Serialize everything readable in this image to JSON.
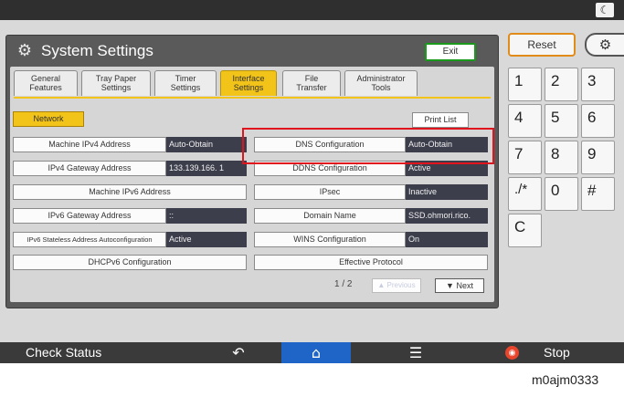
{
  "title": "System Settings",
  "exit_label": "Exit",
  "tabs": [
    {
      "line1": "General",
      "line2": "Features"
    },
    {
      "line1": "Tray Paper",
      "line2": "Settings"
    },
    {
      "line1": "Timer",
      "line2": "Settings"
    },
    {
      "line1": "Interface",
      "line2": "Settings"
    },
    {
      "line1": "File",
      "line2": "Transfer"
    },
    {
      "line1": "Administrator",
      "line2": "Tools"
    }
  ],
  "active_tab_index": 3,
  "network_label": "Network",
  "print_list_label": "Print List",
  "left_items": [
    {
      "label": "Machine IPv4 Address",
      "value": "Auto-Obtain"
    },
    {
      "label": "IPv4 Gateway Address",
      "value": "133.139.166.  1"
    },
    {
      "label": "Machine IPv6 Address",
      "value": ""
    },
    {
      "label": "IPv6 Gateway Address",
      "value": "::"
    },
    {
      "label": "IPv6 Stateless Address Autoconfiguration",
      "value": "Active"
    },
    {
      "label": "DHCPv6 Configuration",
      "value": ""
    }
  ],
  "right_items": [
    {
      "label": "DNS Configuration",
      "value": "Auto-Obtain"
    },
    {
      "label": "DDNS Configuration",
      "value": "Active"
    },
    {
      "label": "IPsec",
      "value": "Inactive"
    },
    {
      "label": "Domain Name",
      "value": "SSD.ohmori.rico."
    },
    {
      "label": "WINS Configuration",
      "value": "On"
    },
    {
      "label": "Effective Protocol",
      "value": ""
    }
  ],
  "pager": "1 / 2",
  "prev_label": "▲ Previous",
  "next_label": "Next",
  "reset_label": "Reset",
  "keypad": [
    "1",
    "2",
    "3",
    "4",
    "5",
    "6",
    "7",
    "8",
    "9",
    "./*",
    "0",
    "#",
    "C"
  ],
  "status_bar": {
    "check_status": "Check Status",
    "stop": "Stop"
  },
  "caption": "m0ajm0333",
  "colors": {
    "accent_tab": "#f2c318",
    "highlight": "#e0141c",
    "value_bg": "#3c3e4c",
    "home_blue": "#1f64c7"
  }
}
